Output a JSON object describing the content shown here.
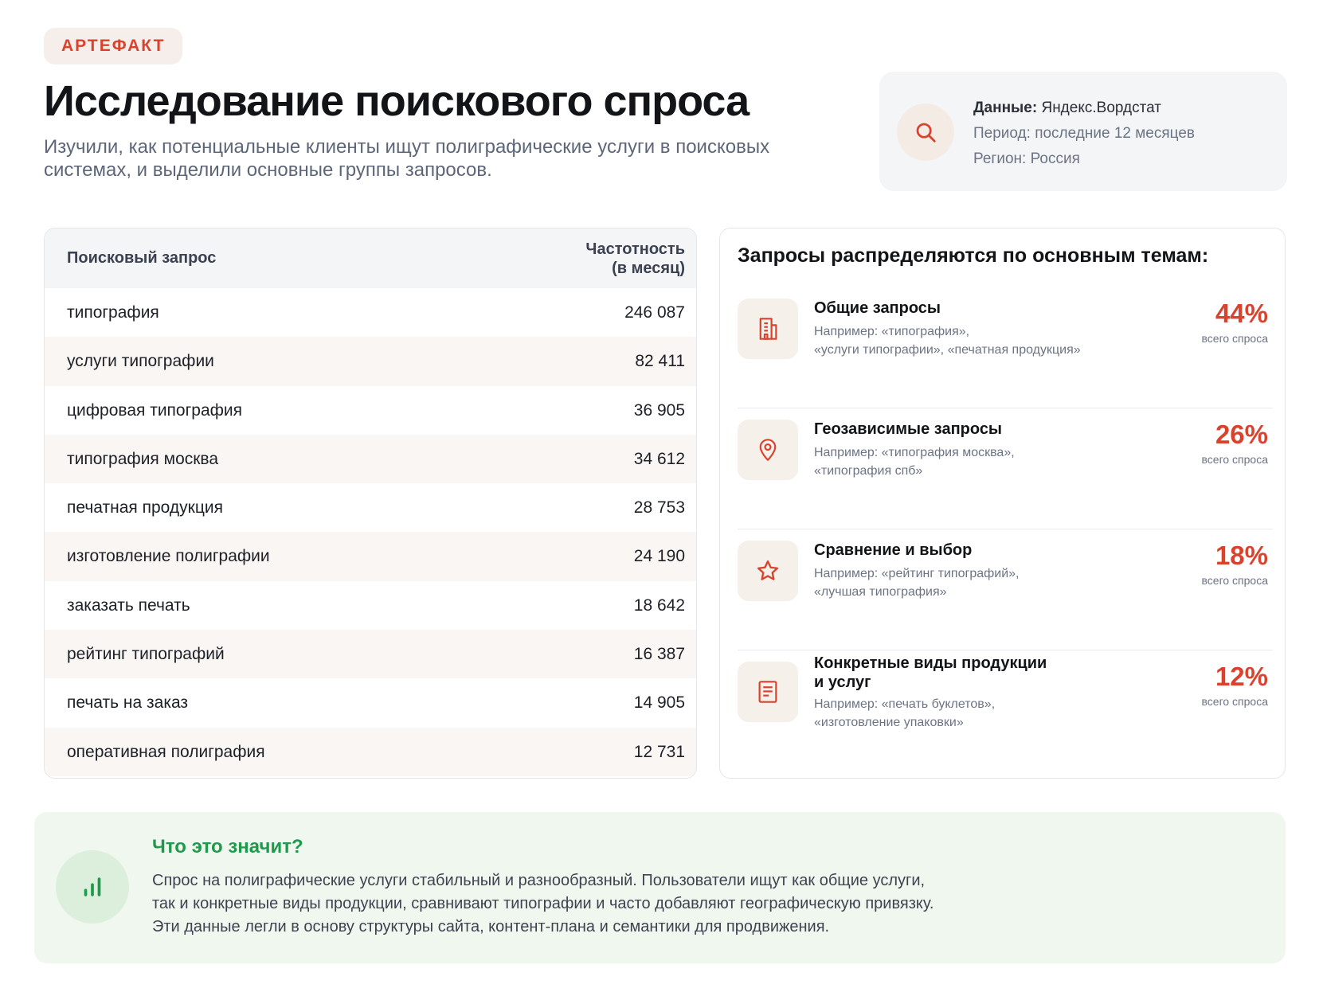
{
  "badge": "АРТЕФАКТ",
  "title": "Исследование поискового спроса",
  "subtitle": "Изучили, как потенциальные клиенты ищут полиграфические услуги в поисковых системах, и выделили основные группы запросов.",
  "info": {
    "data_label": "Данные:",
    "data_value": "Яндекс.Вордстат",
    "period": "Период: последние 12 месяцев",
    "region": "Регион: Россия",
    "icon": "search-icon"
  },
  "table": {
    "col_query": "Поисковый запрос",
    "col_freq_line1": "Частотность",
    "col_freq_line2": "(в месяц)",
    "rows": [
      {
        "query": "типография",
        "freq": "246 087"
      },
      {
        "query": "услуги типографии",
        "freq": "82 411"
      },
      {
        "query": "цифровая типография",
        "freq": "36 905"
      },
      {
        "query": "типография москва",
        "freq": "34 612"
      },
      {
        "query": "печатная продукция",
        "freq": "28 753"
      },
      {
        "query": "изготовление полиграфии",
        "freq": "24 190"
      },
      {
        "query": "заказать печать",
        "freq": "18 642"
      },
      {
        "query": "рейтинг типографий",
        "freq": "16 387"
      },
      {
        "query": "печать на заказ",
        "freq": "14 905"
      },
      {
        "query": "оперативная полиграфия",
        "freq": "12 731"
      }
    ]
  },
  "themes": {
    "title": "Запросы распределяются по основным темам:",
    "items": [
      {
        "name": "Общие запросы",
        "example_1": "Например: «типография»,",
        "example_2": "«услуги типографии», «печатная продукция»",
        "pct": "44%",
        "pct_label": "всего спроса",
        "icon": "building-icon"
      },
      {
        "name": "Геозависимые запросы",
        "example_1": "Например: «типография москва»,",
        "example_2": "«типография спб»",
        "pct": "26%",
        "pct_label": "всего спроса",
        "icon": "map-pin-icon"
      },
      {
        "name": "Сравнение и выбор",
        "example_1": "Например: «рейтинг типографий»,",
        "example_2": "«лучшая типография»",
        "pct": "18%",
        "pct_label": "всего спроса",
        "icon": "star-icon"
      },
      {
        "name_1": "Конкретные виды продукции",
        "name_2": "и услуг",
        "example_1": "Например: «печать буклетов»,",
        "example_2": "«изготовление упаковки»",
        "pct": "12%",
        "pct_label": "всего спроса",
        "icon": "document-icon"
      }
    ]
  },
  "summary": {
    "title": "Что это значит?",
    "line_1": "Спрос на полиграфические услуги стабильный и разнообразный. Пользователи ищут как общие услуги,",
    "line_2": "так и конкретные виды продукции, сравнивают типографии и часто добавляют географическую привязку.",
    "line_3": "Эти данные легли в основу структуры сайта, контент-плана и семантики для продвижения.",
    "icon": "bar-chart-icon"
  },
  "colors": {
    "accent": "#d9432e",
    "green": "#1f9a4c",
    "muted": "#6b7384"
  }
}
